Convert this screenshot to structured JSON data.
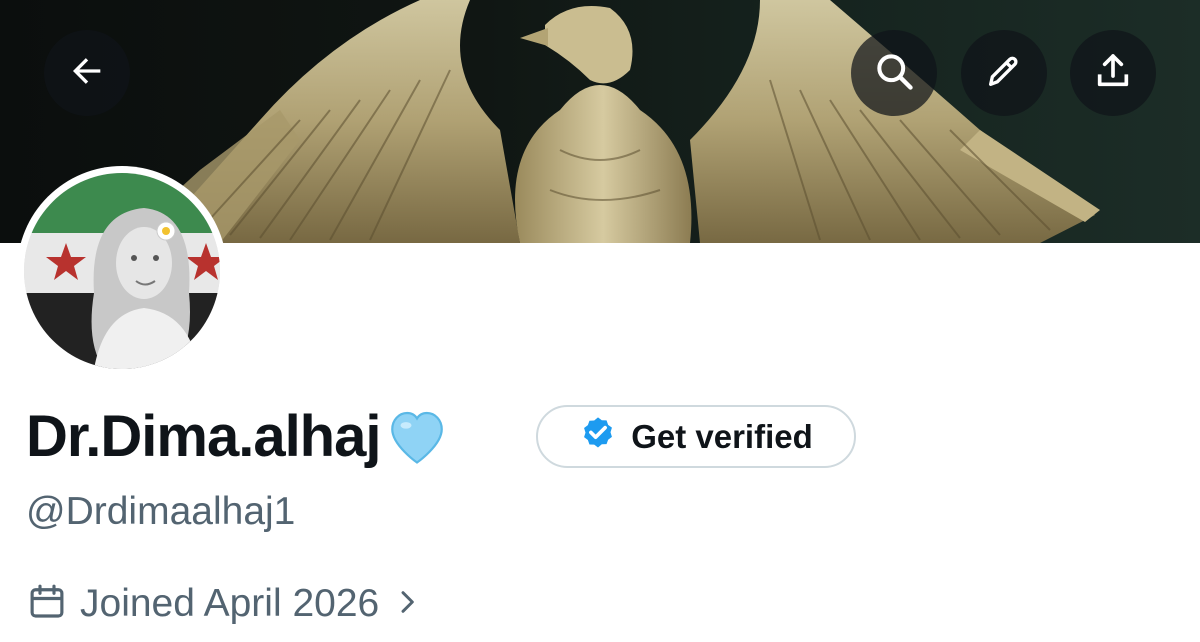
{
  "header": {
    "back_icon": "arrow-left-icon",
    "actions": [
      {
        "name": "search",
        "icon": "search-icon"
      },
      {
        "name": "edit",
        "icon": "pencil-icon"
      },
      {
        "name": "share",
        "icon": "share-upload-icon"
      }
    ]
  },
  "profile": {
    "display_name": "Dr.Dima.alhaj",
    "name_emoji": "light-blue-heart-icon",
    "handle": "@Drdimaalhaj1",
    "joined": "Joined April 2026",
    "get_verified_label": "Get verified"
  },
  "colors": {
    "text_primary": "#0f1419",
    "text_secondary": "#536471",
    "verified_blue": "#1d9bf0",
    "border": "#cfd9de",
    "heart": "#8fd3f5"
  }
}
